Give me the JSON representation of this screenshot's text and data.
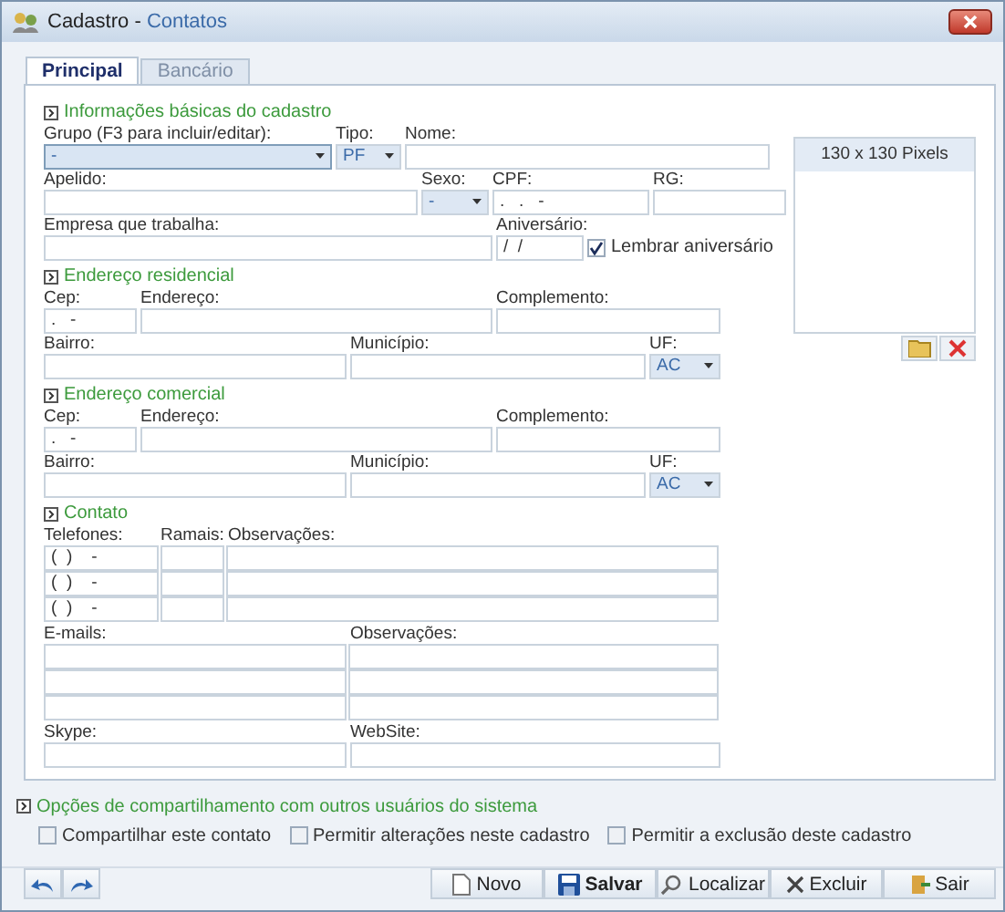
{
  "window": {
    "title": "Cadastro",
    "separator": "-",
    "subtitle": "Contatos"
  },
  "tabs": [
    {
      "label": "Principal",
      "selected": true
    },
    {
      "label": "Bancário",
      "selected": false
    }
  ],
  "basic_info": {
    "heading": "Informações básicas do cadastro",
    "fields": [
      {
        "label": "Grupo (F3 para incluir/editar):",
        "kind": "combo",
        "value": "-",
        "focused": true
      },
      {
        "label": "Tipo:",
        "kind": "combo",
        "value": "PF"
      },
      {
        "label": "Nome:",
        "kind": "text"
      },
      {
        "label": "Apelido:",
        "kind": "text"
      },
      {
        "label": "Sexo:",
        "kind": "combo",
        "value": "-"
      },
      {
        "label": "CPF:",
        "kind": "text",
        "value": ".   .   -"
      },
      {
        "label": "RG:",
        "kind": "text"
      },
      {
        "label": "Empresa que trabalha:",
        "kind": "text"
      },
      {
        "label": "Aniversário:",
        "kind": "text",
        "value": "/  /"
      },
      {
        "label": "Lembrar aniversário",
        "kind": "checkbox",
        "checked": true
      }
    ]
  },
  "photo": {
    "caption": "130 x 130 Pixels"
  },
  "addresses": [
    {
      "heading": "Endereço residencial",
      "fields": [
        {
          "label": "Cep:",
          "kind": "text",
          "value": ".   -"
        },
        {
          "label": "Endereço:",
          "kind": "text"
        },
        {
          "label": "Complemento:",
          "kind": "text"
        },
        {
          "label": "Bairro:",
          "kind": "text"
        },
        {
          "label": "Município:",
          "kind": "text"
        },
        {
          "label": "UF:",
          "kind": "combo",
          "value": "AC"
        }
      ]
    },
    {
      "heading": "Endereço comercial",
      "fields": [
        {
          "label": "Cep:",
          "kind": "text",
          "value": ".   -"
        },
        {
          "label": "Endereço:",
          "kind": "text"
        },
        {
          "label": "Complemento:",
          "kind": "text"
        },
        {
          "label": "Bairro:",
          "kind": "text"
        },
        {
          "label": "Município:",
          "kind": "text"
        },
        {
          "label": "UF:",
          "kind": "combo",
          "value": "AC"
        }
      ]
    }
  ],
  "contact": {
    "heading": "Contato",
    "phone_columns": [
      "Telefones:",
      "Ramais:",
      "Observações:"
    ],
    "phones": [
      {
        "number": "(  )    -"
      },
      {
        "number": "(  )    -"
      },
      {
        "number": "(  )    -"
      }
    ],
    "email_columns": [
      "E-mails:",
      "Observações:"
    ],
    "extra": [
      {
        "label": "Skype:"
      },
      {
        "label": "WebSite:"
      }
    ]
  },
  "sharing": {
    "heading": "Opções de compartilhamento com outros usuários do sistema",
    "options": [
      {
        "label": "Compartilhar este contato",
        "checked": false
      },
      {
        "label": "Permitir alterações neste cadastro",
        "checked": false
      },
      {
        "label": "Permitir a exclusão deste cadastro",
        "checked": false
      }
    ]
  },
  "nav_buttons": [
    {
      "kind": "undo"
    },
    {
      "kind": "redo"
    }
  ],
  "buttons": [
    {
      "label": "Novo",
      "kind": "new"
    },
    {
      "label": "Salvar",
      "kind": "save"
    },
    {
      "label": "Localizar",
      "kind": "find"
    },
    {
      "label": "Excluir",
      "kind": "delete"
    },
    {
      "label": "Sair",
      "kind": "exit"
    }
  ]
}
